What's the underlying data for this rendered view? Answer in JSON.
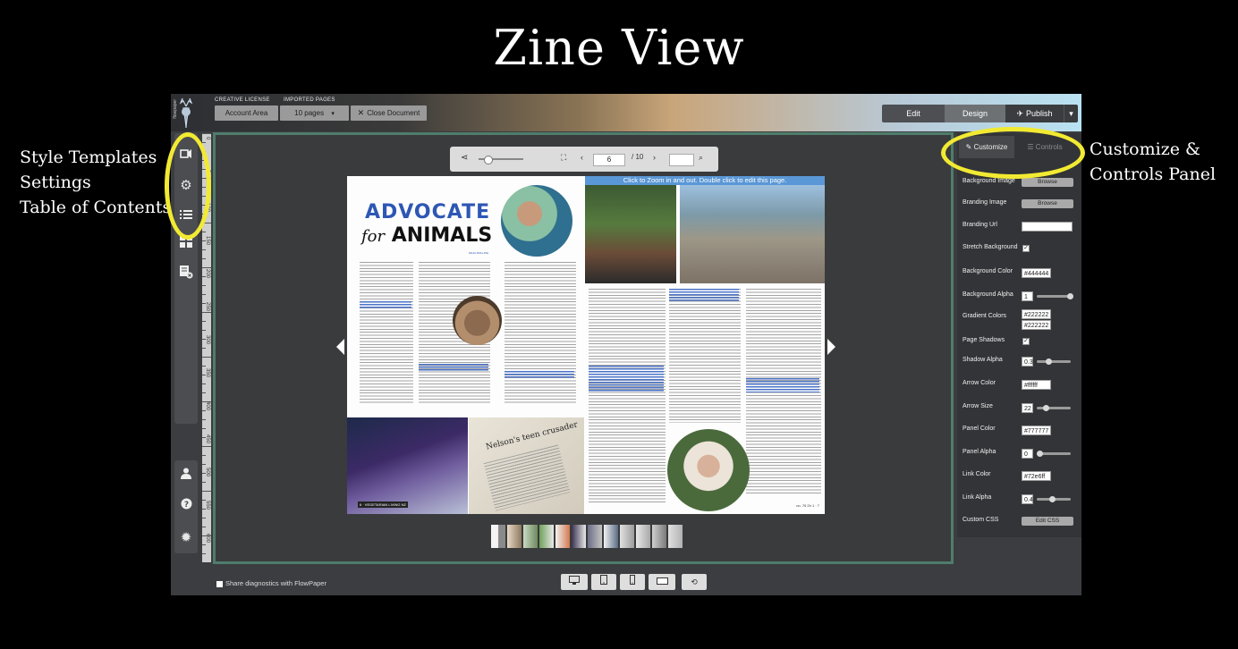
{
  "heading": "Zine View",
  "annotations": {
    "left_lines": [
      "Style Templates",
      "Settings",
      "Table of Contents"
    ],
    "right_lines": [
      "Customize &",
      "Controls Panel"
    ]
  },
  "app": {
    "logo_text": "flowpaper",
    "topbar": {
      "license_label": "CREATIVE LICENSE",
      "imported_label": "IMPORTED PAGES",
      "account_button": "Account Area",
      "pages_button": "10 pages",
      "close_button": "Close Document",
      "mode_edit": "Edit",
      "mode_design": "Design",
      "mode_publish": "Publish"
    },
    "ruler_numbers": [
      "0",
      "50",
      "100",
      "150",
      "200",
      "250",
      "300",
      "350",
      "400",
      "450",
      "500",
      "550",
      "600"
    ],
    "viewer": {
      "page_current": "6",
      "page_total": "/ 10",
      "zoom_hint": "Click to Zoom in and out. Double click to edit this page."
    },
    "zine": {
      "title_line1": "ADVOCATE",
      "title_for": "for",
      "title_line2": "ANIMALS",
      "byline": "MAJA SKILLING",
      "clipping_title": "Nelson's teen crusader",
      "footer_left": "6 · VEGETARIAN LIVING NZ",
      "footer_right": "no. 76 2h 1 · 7"
    },
    "panel": {
      "tab_customize": "Customize",
      "tab_controls": "Controls",
      "fields": [
        {
          "label": "Background Image",
          "type": "button",
          "value": "Browse"
        },
        {
          "label": "Branding Image",
          "type": "button",
          "value": "Browse"
        },
        {
          "label": "Branding Url",
          "type": "input",
          "value": ""
        },
        {
          "label": "Stretch Background",
          "type": "check",
          "value": "✓"
        },
        {
          "label": "Background Color",
          "type": "input",
          "value": "#444444"
        },
        {
          "label": "Background Alpha",
          "type": "slider",
          "value": "1"
        },
        {
          "label": "Gradient Colors",
          "type": "input2",
          "value": "#222222",
          "value2": "#222222"
        },
        {
          "label": "Page Shadows",
          "type": "check",
          "value": "✓"
        },
        {
          "label": "Shadow Alpha",
          "type": "slider",
          "value": "0.3"
        },
        {
          "label": "Arrow Color",
          "type": "input",
          "value": "#ffffff"
        },
        {
          "label": "Arrow Size",
          "type": "slider",
          "value": "22"
        },
        {
          "label": "Panel Color",
          "type": "input",
          "value": "#777777"
        },
        {
          "label": "Panel Alpha",
          "type": "slider",
          "value": "0"
        },
        {
          "label": "Link Color",
          "type": "input",
          "value": "#72e6ff"
        },
        {
          "label": "Link Alpha",
          "type": "slider",
          "value": "0.4"
        },
        {
          "label": "Custom CSS",
          "type": "button",
          "value": "Edit CSS"
        }
      ],
      "slider_levels": {
        "Background Alpha": 1.0,
        "Shadow Alpha": 0.3,
        "Arrow Size": 0.22,
        "Panel Alpha": 0.0,
        "Link Alpha": 0.4
      }
    },
    "diagnostics_label": "Share diagnostics with FlowPaper",
    "colors": {
      "annotation_yellow": "#f2ea32",
      "stage_border": "#4f7d6b",
      "zine_blue": "#2d57b4",
      "link_hint_blue": "#5a97d6"
    },
    "icons": {
      "sidebar": [
        "style-templates-icon",
        "settings-gear-icon",
        "table-of-contents-icon",
        "grid-view-icon",
        "page-remove-icon"
      ],
      "sidebar_bottom": [
        "user-icon",
        "help-icon",
        "bug-icon"
      ],
      "viewer_toolbar": [
        "share-icon",
        "fullscreen-icon",
        "chevron-left-icon",
        "chevron-right-icon",
        "search-icon"
      ],
      "bottom_devices": [
        "desktop-icon",
        "tablet-icon",
        "phone-icon",
        "landscape-icon",
        "rotate-icon"
      ]
    }
  }
}
